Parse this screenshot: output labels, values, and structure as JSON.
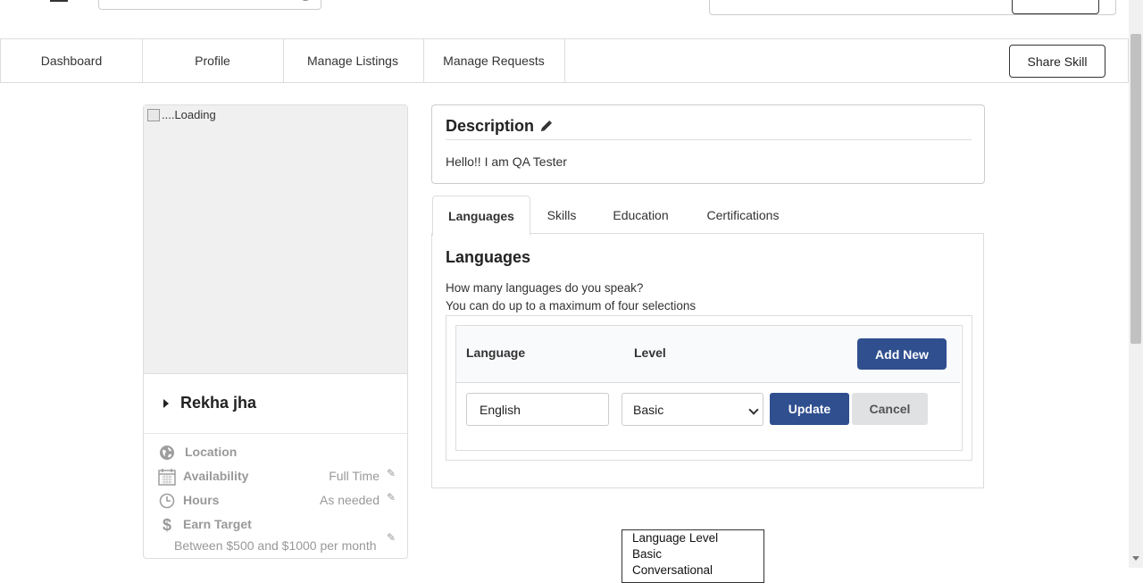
{
  "nav": {
    "items": [
      {
        "label": "Dashboard"
      },
      {
        "label": "Profile"
      },
      {
        "label": "Manage Listings"
      },
      {
        "label": "Manage Requests"
      }
    ],
    "share_label": "Share Skill"
  },
  "profile": {
    "photo_alt": "....Loading",
    "name": "Rekha jha",
    "location_label": "Location",
    "availability_label": "Availability",
    "availability_value": "Full Time",
    "hours_label": "Hours",
    "hours_value": "As needed",
    "earn_label": "Earn Target",
    "earn_value": "Between $500 and $1000 per month"
  },
  "description": {
    "title": "Description",
    "text": "Hello!! I am QA Tester"
  },
  "tabs": [
    {
      "label": "Languages"
    },
    {
      "label": "Skills"
    },
    {
      "label": "Education"
    },
    {
      "label": "Certifications"
    }
  ],
  "languages": {
    "title": "Languages",
    "question": "How many languages do you speak?",
    "hint": "You can do up to a maximum of four selections",
    "col_language": "Language",
    "col_level": "Level",
    "add_label": "Add New",
    "input_value": "English",
    "selected_level": "Basic",
    "update_label": "Update",
    "cancel_label": "Cancel",
    "dropdown_options": [
      "Language Level",
      "Basic",
      "Conversational"
    ]
  },
  "colors": {
    "primary": "#2f4f8f",
    "muted": "#999999",
    "secondary_button": "#e0e1e2"
  }
}
